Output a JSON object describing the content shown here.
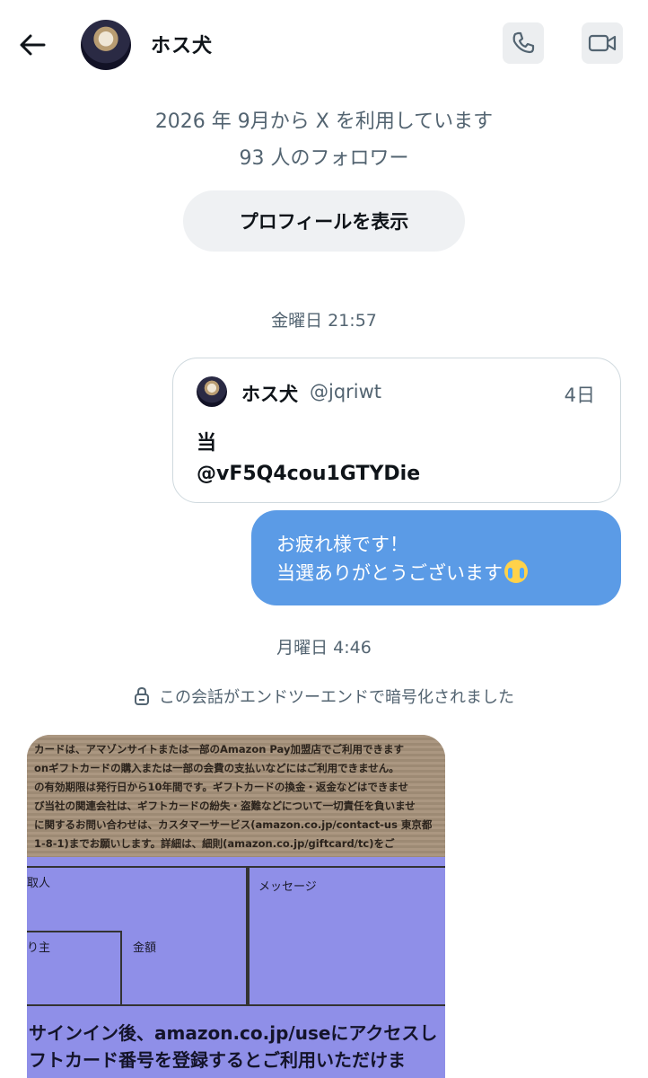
{
  "header": {
    "back_icon": "arrow-left-icon",
    "name": "ホス犬",
    "call_icon": "phone-icon",
    "video_icon": "video-camera-icon"
  },
  "profile": {
    "since": "2026 年 9月から X を利用しています",
    "followers": "93 人のフォロワー",
    "view_profile_label": "プロフィールを表示"
  },
  "messages": {
    "timestamp_1": "金曜日 21:57",
    "quote": {
      "name": "ホス犬",
      "handle": "@jqriwt",
      "date": "4日",
      "line1": "当",
      "line2": "@vF5Q4cou1GTYDie"
    },
    "bubble": {
      "line1": "お疲れ様です！",
      "line2": "当選ありがとうございます",
      "emoji": "loudly-crying-face-emoji"
    },
    "timestamp_2": "月曜日 4:46",
    "encryption_notice": "この会話がエンドツーエンドで暗号化されました",
    "lock_icon": "lock-icon"
  },
  "photo": {
    "card_lines": [
      "カードは、アマゾンサイトまたは一部のAmazon Pay加盟店でご利用できます",
      "onギフトカードの購入または一部の会費の支払いなどにはご利用できません。",
      "の有効期限は発行日から10年間です。ギフトカードの換金・返金などはできませ",
      "び当社の関連会社は、ギフトカードの紛失・盗難などについて一切責任を負いませ",
      "に関するお問い合わせは、カスタマーサービス(amazon.co.jp/contact-us 東京都",
      "1-8-1)までお願いします。詳細は、細則(amazon.co.jp/giftcard/tc)をご"
    ],
    "recipient_label": "取人",
    "message_label": "メッセージ",
    "sender_label": "り主",
    "amount_label": "金額",
    "instruction_line1": "サインイン後、amazon.co.jp/useにアクセスし",
    "instruction_line2": "フトカード番号を登録するとご利用いただけま"
  }
}
